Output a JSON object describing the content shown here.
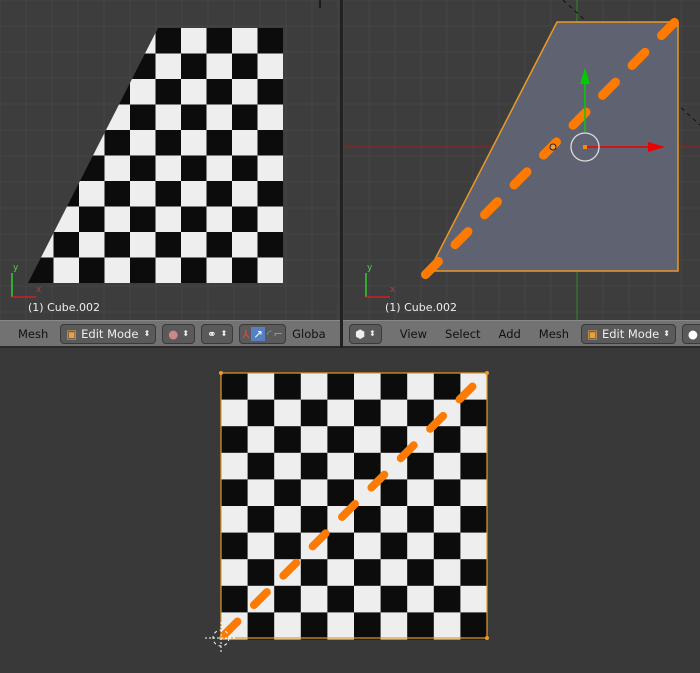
{
  "left_viewport": {
    "object_label": "(1) Cube.002",
    "axis_x": "x",
    "axis_y": "y"
  },
  "left_header": {
    "menu_mesh": "Mesh",
    "mode": "Edit Mode",
    "orientation": "Globa"
  },
  "right_viewport": {
    "object_label": "(1) Cube.002",
    "axis_x": "x",
    "axis_y": "y"
  },
  "right_header": {
    "menus": [
      "View",
      "Select",
      "Add",
      "Mesh"
    ],
    "mode": "Edit Mode"
  },
  "colors": {
    "accent": "#ff7a00",
    "mesh_face": "#5f6270",
    "edge_selected": "#e89a28"
  }
}
